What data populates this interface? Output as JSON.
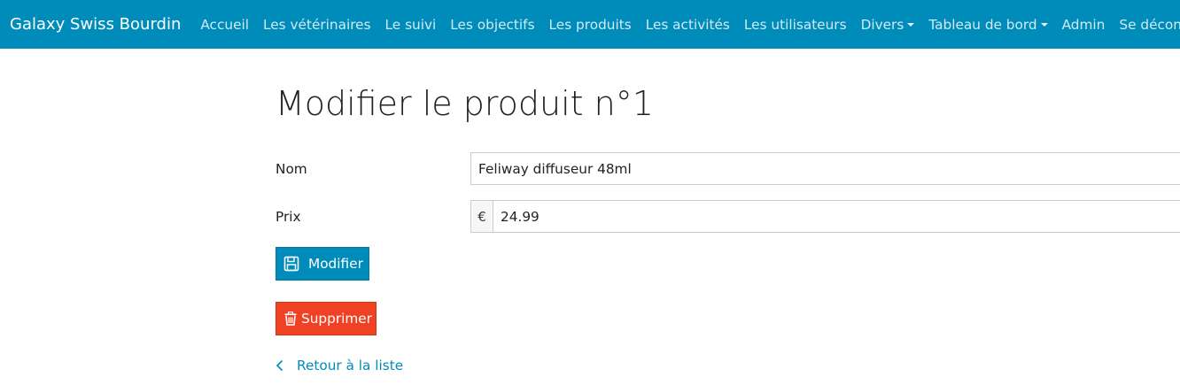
{
  "navbar": {
    "brand": "Galaxy Swiss Bourdin",
    "items": [
      {
        "label": "Accueil"
      },
      {
        "label": "Les vétérinaires"
      },
      {
        "label": "Le suivi"
      },
      {
        "label": "Les objectifs"
      },
      {
        "label": "Les produits"
      },
      {
        "label": "Les activités"
      },
      {
        "label": "Les utilisateurs"
      },
      {
        "label": "Divers"
      },
      {
        "label": "Tableau de bord"
      },
      {
        "label": "Admin"
      },
      {
        "label": "Se déconnecter"
      }
    ],
    "color": "#008cba"
  },
  "page": {
    "title": "Modifier le produit n°1"
  },
  "form": {
    "name_label": "Nom",
    "name_value": "Feliway diffuseur 48ml",
    "price_label": "Prix",
    "price_addon": "€",
    "price_value": "24.99"
  },
  "actions": {
    "modify_label": "Modifier",
    "modify_icon": "save-icon",
    "delete_label": "Supprimer",
    "delete_icon": "trash-icon",
    "delete_color": "#f04124",
    "back_label": "Retour à la liste",
    "back_icon": "chevron-left-icon"
  }
}
